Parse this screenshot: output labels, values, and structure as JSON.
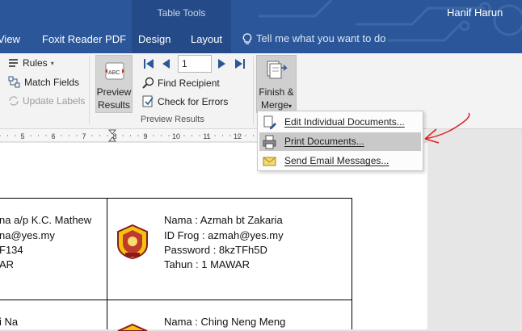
{
  "title_bar": {
    "context_tab_group": "Table Tools",
    "user_name": "Hanif Harun"
  },
  "tabs": [
    {
      "label": "View"
    },
    {
      "label": "Foxit Reader PDF"
    },
    {
      "label": "Design"
    },
    {
      "label": "Layout"
    }
  ],
  "tell_me": {
    "placeholder": "Tell me what you want to do"
  },
  "ribbon": {
    "rules_label": "Rules",
    "match_fields_label": "Match Fields",
    "update_labels_label": "Update Labels",
    "preview_results_line1": "Preview",
    "preview_results_line2": "Results",
    "record_number": "1",
    "find_recipient_label": "Find Recipient",
    "check_errors_label": "Check for Errors",
    "group_label": "Preview Results",
    "finish_merge_line1": "Finish &",
    "finish_merge_line2": "Merge"
  },
  "ruler_labels": [
    "5",
    "6",
    "7",
    "8",
    "9",
    "10",
    "11",
    "12"
  ],
  "finish_menu": {
    "items": [
      {
        "label": "Edit Individual Documents..."
      },
      {
        "label": "Print Documents..."
      },
      {
        "label": "Send Email Messages..."
      }
    ]
  },
  "document": {
    "left_cell": {
      "line1": "na a/p K.C. Mathew",
      "line2": "na@yes.my",
      "line3": "F134",
      "line4": "AR",
      "line5": "i Na"
    },
    "right_cell": {
      "line1": "Nama : Azmah bt Zakaria",
      "line2": "ID Frog : azmah@yes.my",
      "line3": "Password : 8kzTFh5D",
      "line4": "Tahun : 1 MAWAR"
    },
    "next_row": {
      "line1": "Nama : Ching Neng Meng"
    }
  },
  "colors": {
    "title_bar": "#2b579a",
    "context_group": "#244b88",
    "annotation": "#e02020"
  }
}
